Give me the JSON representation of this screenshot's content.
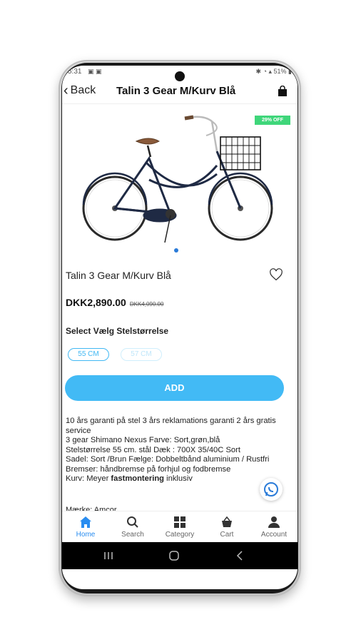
{
  "status": {
    "time": "5:31",
    "battery": "51%"
  },
  "header": {
    "back_label": "Back",
    "title": "Talin 3 Gear M/Kurv Blå"
  },
  "product": {
    "badge": "29% OFF",
    "name": "Talin 3 Gear M/Kurv Blå",
    "price": "DKK2,890.00",
    "old_price": "DKK4,090.00",
    "select_label": "Select Vælg Stelstørrelse",
    "sizes": [
      {
        "label": "55 CM",
        "selected": true
      },
      {
        "label": "57 CM",
        "selected": false
      }
    ],
    "add_label": "ADD",
    "description": [
      "10 års garanti på stel 3 års reklamations garanti 2 års gratis service",
      "3 gear Shimano Nexus Farve:  Sort,grøn,blå",
      "Stelstørrelse 55 cm. stål Dæk : 700X 35/40C Sort",
      "Sadel: Sort /Brun Fælge: Dobbeltbånd aluminium / Rustfri Bremser: håndbremse på forhjul og fodbremse"
    ],
    "desc_last_prefix": "Kurv: Meyer ",
    "desc_last_bold": "fastmontering",
    "desc_last_suffix": " inklusiv",
    "cut_line": "Mærke:  Amcor"
  },
  "nav": {
    "items": [
      {
        "label": "Home",
        "icon": "home-icon",
        "active": true
      },
      {
        "label": "Search",
        "icon": "search-icon",
        "active": false
      },
      {
        "label": "Category",
        "icon": "grid-icon",
        "active": false
      },
      {
        "label": "Cart",
        "icon": "basket-icon",
        "active": false
      },
      {
        "label": "Account",
        "icon": "user-icon",
        "active": false
      }
    ]
  },
  "colors": {
    "accent": "#42baf5",
    "nav_active": "#2a8df0",
    "badge": "#3fd67a",
    "bike_frame": "#1f2a44",
    "saddle": "#8a5a3a"
  }
}
